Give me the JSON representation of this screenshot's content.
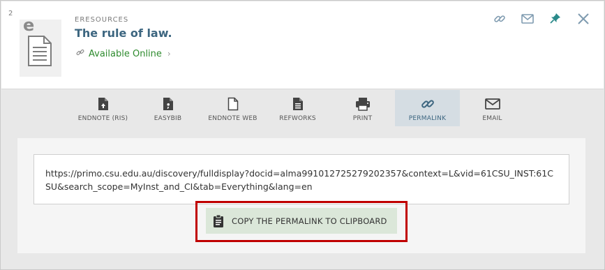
{
  "record": {
    "number": "2",
    "resource_type": "ERESOURCES",
    "title": "The rule of law.",
    "availability": "Available Online",
    "thumbnail_letter": "e"
  },
  "top_actions": [
    {
      "icon": "link-icon"
    },
    {
      "icon": "mail-icon"
    },
    {
      "icon": "pin-icon"
    },
    {
      "icon": "close-icon"
    }
  ],
  "toolbar": {
    "items": [
      {
        "label": "ENDNOTE (RIS)",
        "icon": "endnote-ris-icon"
      },
      {
        "label": "EASYBIB",
        "icon": "easybib-icon"
      },
      {
        "label": "ENDNOTE WEB",
        "icon": "endnote-web-icon"
      },
      {
        "label": "REFWORKS",
        "icon": "refworks-icon"
      },
      {
        "label": "PRINT",
        "icon": "print-icon"
      },
      {
        "label": "PERMALINK",
        "icon": "permalink-icon",
        "active": true
      },
      {
        "label": "EMAIL",
        "icon": "email-icon"
      }
    ]
  },
  "permalink": {
    "url": "https://primo.csu.edu.au/discovery/fulldisplay?docid=alma991012725279202357&context=L&vid=61CSU_INST:61CSU&search_scope=MyInst_and_CI&tab=Everything&lang=en",
    "copy_label": "COPY THE PERMALINK TO CLIPBOARD"
  },
  "colors": {
    "title": "#3d6680",
    "available": "#2e8b2e",
    "active_tab_bg": "#d5dde3",
    "copy_button_bg": "#dbe7d9",
    "highlight_border": "#c00000",
    "pin": "#2a8a8a"
  }
}
